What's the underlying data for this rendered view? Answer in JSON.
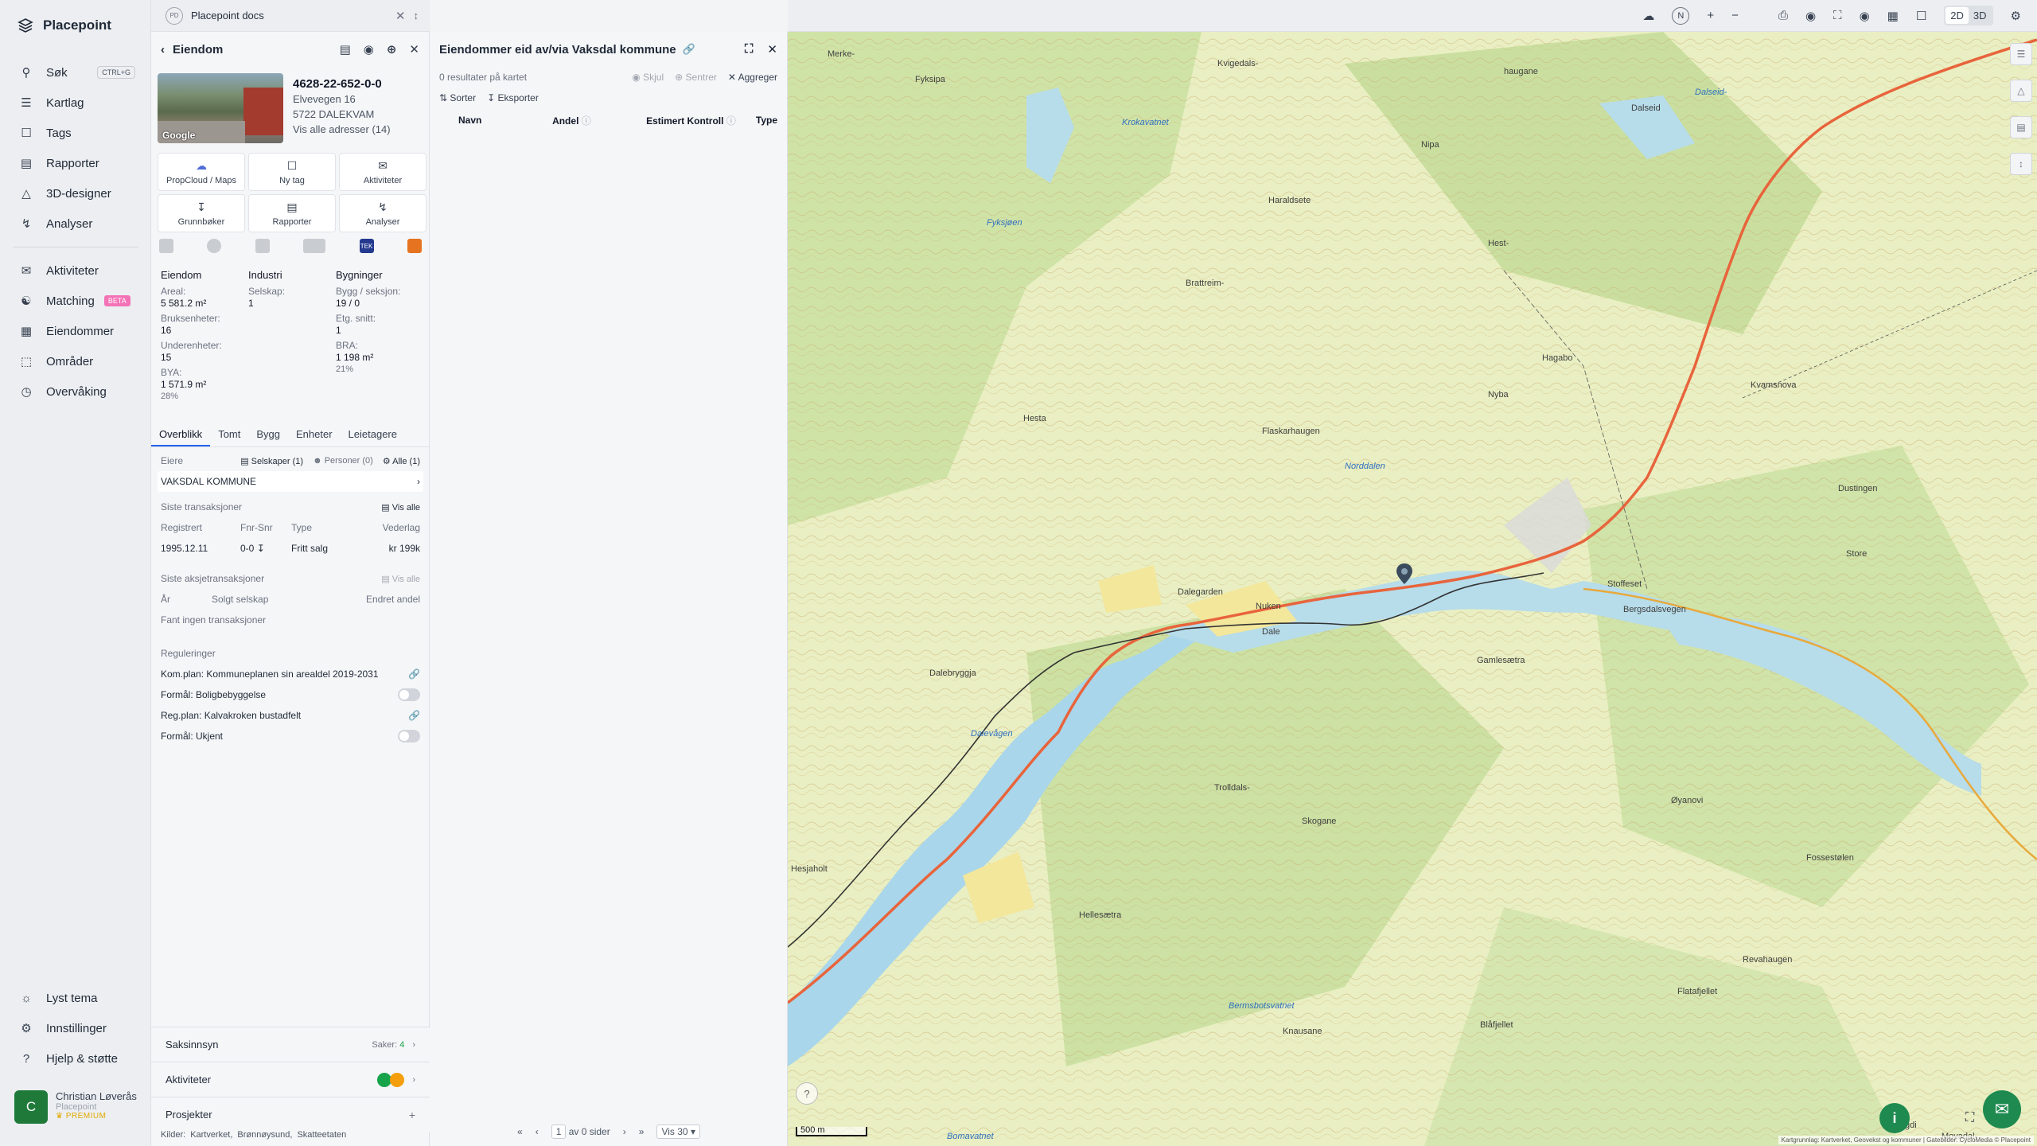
{
  "app": {
    "name": "Placepoint"
  },
  "sidebar": {
    "items": [
      {
        "label": "Søk",
        "icon": "search-icon",
        "kbd": "CTRL+G"
      },
      {
        "label": "Kartlag",
        "icon": "layers-icon"
      },
      {
        "label": "Tags",
        "icon": "bookmark-icon"
      },
      {
        "label": "Rapporter",
        "icon": "bar-chart-icon"
      },
      {
        "label": "3D-designer",
        "icon": "cube-icon"
      },
      {
        "label": "Analyser",
        "icon": "bolt-icon"
      }
    ],
    "items2": [
      {
        "label": "Aktiviteter",
        "icon": "chat-icon"
      },
      {
        "label": "Matching",
        "icon": "handshake-icon",
        "badge": "BETA"
      },
      {
        "label": "Eiendommer",
        "icon": "building-icon"
      },
      {
        "label": "Områder",
        "icon": "area-icon"
      },
      {
        "label": "Overvåking",
        "icon": "monitor-icon"
      }
    ],
    "bottom": [
      {
        "label": "Lyst tema",
        "icon": "sun-icon"
      },
      {
        "label": "Innstillinger",
        "icon": "gear-icon"
      },
      {
        "label": "Hjelp & støtte",
        "icon": "help-icon"
      }
    ],
    "user": {
      "initial": "C",
      "name": "Christian Løverås",
      "org": "Placepoint",
      "plan": "PREMIUM"
    }
  },
  "docstab": {
    "badge": "PD",
    "label": "Placepoint docs"
  },
  "property": {
    "title": "Eiendom",
    "id": "4628-22-652-0-0",
    "street": "Elvevegen 16",
    "postal": "5722 DALEKVAM",
    "all_addresses": "Vis alle adresser (14)",
    "photo_label": "Google",
    "tiles": [
      {
        "label": "PropCloud / Maps",
        "icon": "cloud-icon"
      },
      {
        "label": "Ny tag",
        "icon": "bookmark-icon"
      },
      {
        "label": "Aktiviteter",
        "icon": "chat-icon"
      },
      {
        "label": "Grunnbøker",
        "icon": "download-icon"
      },
      {
        "label": "Rapporter",
        "icon": "bar-chart-icon"
      },
      {
        "label": "Analyser",
        "icon": "bolt-icon"
      }
    ],
    "stats": {
      "col1_head": "Eiendom",
      "areal_l": "Areal:",
      "areal_v": "5 581.2 m²",
      "bruks_l": "Bruksenheter:",
      "bruks_v": "16",
      "under_l": "Underenheter:",
      "under_v": "15",
      "bya_l": "BYA:",
      "bya_v": "1 571.9 m²",
      "bya_p": "28%",
      "col2_head": "Industri",
      "selskap_l": "Selskap:",
      "selskap_v": "1",
      "col3_head": "Bygninger",
      "bygg_l": "Bygg / seksjon:",
      "bygg_v": "19 / 0",
      "etg_l": "Etg. snitt:",
      "etg_v": "1",
      "bra_l": "BRA:",
      "bra_v": "1 198 m²",
      "bra_p": "21%"
    },
    "tabs": [
      "Overblikk",
      "Tomt",
      "Bygg",
      "Enheter",
      "Leietagere"
    ],
    "owners": {
      "label": "Eiere",
      "companies": "Selskaper (1)",
      "persons": "Personer (0)",
      "all": "Alle (1)",
      "owner": "VAKSDAL KOMMUNE"
    },
    "transactions": {
      "label": "Siste transaksjoner",
      "show_all": "Vis alle",
      "headers": [
        "Registrert",
        "Fnr-Snr",
        "Type",
        "Vederlag"
      ],
      "row": [
        "1995.12.11",
        "0-0",
        "Fritt salg",
        "kr 199k"
      ]
    },
    "share_tx": {
      "label": "Siste aksjetransaksjoner",
      "show_all": "Vis alle",
      "headers": [
        "År",
        "Solgt selskap",
        "Endret andel"
      ],
      "empty": "Fant ingen transaksjoner"
    },
    "regulations": {
      "label": "Reguleringer",
      "items": [
        "Kom.plan: Kommuneplanen sin arealdel 2019-2031",
        "Formål: Boligbebyggelse",
        "Reg.plan: Kalvakroken bustadfelt",
        "Formål: Ukjent"
      ]
    },
    "footer": {
      "saksinnsyn": "Saksinnsyn",
      "saker": "Saker:",
      "saker_n": "4",
      "aktiviteter": "Aktiviteter",
      "prosjekter": "Prosjekter",
      "sources": "Kilder:",
      "src1": "Kartverket,",
      "src2": "Brønnøysund,",
      "src3": "Skatteetaten"
    }
  },
  "results": {
    "title": "Eiendommer eid av/via Vaksdal kommune",
    "count": "0 resultater på kartet",
    "hide": "Skjul",
    "center": "Sentrer",
    "aggregate": "Aggreger",
    "sort": "Sorter",
    "export": "Eksporter",
    "columns": [
      "Navn",
      "Andel",
      "Estimert Kontroll",
      "Type"
    ],
    "pager": {
      "page": "1",
      "of": "av 0 sider",
      "show": "Vis 30"
    }
  },
  "map": {
    "mode_2d": "2D",
    "mode_3d": "3D",
    "scale": "500 m",
    "attribution": "Kartgrunnlag: Kartverket, Geovekst og kommuner | Gatebilder: CycloMedia © Placepoint",
    "labels": [
      {
        "t": "Merke-",
        "w": false
      },
      {
        "t": "Kvigedals-",
        "w": false
      },
      {
        "t": "haugane",
        "w": false
      },
      {
        "t": "Fyksipa",
        "w": false
      },
      {
        "t": "Krokavatnet",
        "w": true
      },
      {
        "t": "Nipa",
        "w": false
      },
      {
        "t": "Dalseid",
        "w": false
      },
      {
        "t": "Dalseid-",
        "w": true
      },
      {
        "t": "Fyksjøen",
        "w": true
      },
      {
        "t": "Haraldsete",
        "w": false
      },
      {
        "t": "Hest-",
        "w": false
      },
      {
        "t": "Brattreim-",
        "w": false
      },
      {
        "t": "Hesta",
        "w": false
      },
      {
        "t": "Flaskarhaugen",
        "w": false
      },
      {
        "t": "Norddalen",
        "w": false
      },
      {
        "t": "Hagabo",
        "w": false
      },
      {
        "t": "Nyba",
        "w": false
      },
      {
        "t": "Kvamsnova",
        "w": false
      },
      {
        "t": "Dalegarden",
        "w": false
      },
      {
        "t": "Nuken",
        "w": false
      },
      {
        "t": "Dale",
        "w": false
      },
      {
        "t": "Dalebryggja",
        "w": false
      },
      {
        "t": "Gamlesætra",
        "w": false
      },
      {
        "t": "Stoffeset",
        "w": false
      },
      {
        "t": "Bergsdalsvegen",
        "w": false
      },
      {
        "t": "Dalevågen",
        "w": true
      },
      {
        "t": "Trolldals-",
        "w": false
      },
      {
        "t": "Skogane",
        "w": false
      },
      {
        "t": "Hellesætra",
        "w": false
      },
      {
        "t": "Bermsbotsvatnet",
        "w": true
      },
      {
        "t": "Knausane",
        "w": false
      },
      {
        "t": "Blåfjellet",
        "w": false
      },
      {
        "t": "Flatafjellet",
        "w": false
      },
      {
        "t": "Fossestølen",
        "w": false
      },
      {
        "t": "Dustingen",
        "w": false
      },
      {
        "t": "Store",
        "w": false
      },
      {
        "t": "Øyanovi",
        "w": false
      },
      {
        "t": "Revahaugen",
        "w": false
      },
      {
        "t": "Hesjaholt",
        "w": false
      },
      {
        "t": "Bomavatnet",
        "w": true
      },
      {
        "t": "Hegdi",
        "w": false
      },
      {
        "t": "Moyadal-",
        "w": false
      }
    ]
  }
}
